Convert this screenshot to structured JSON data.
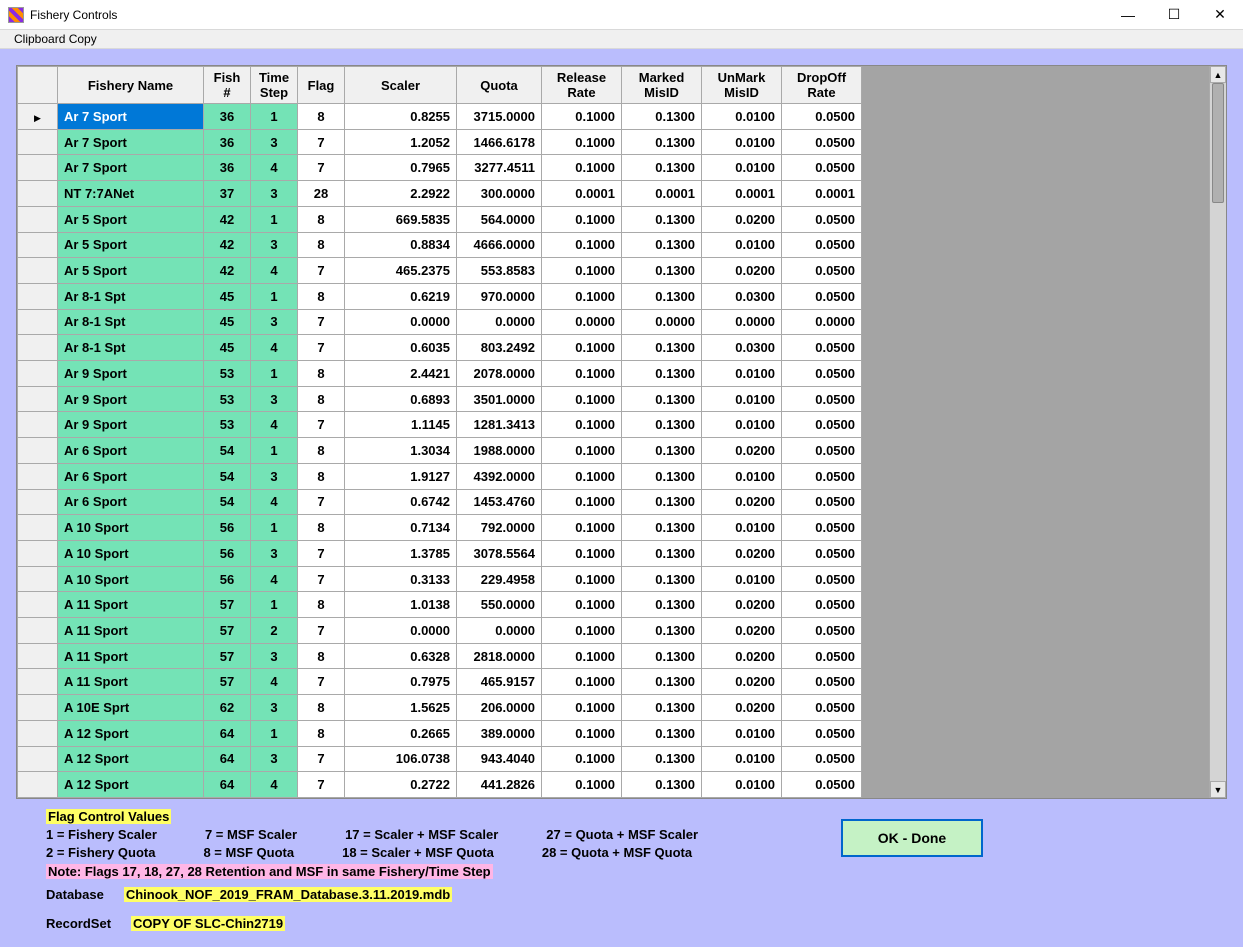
{
  "window": {
    "title": "Fishery Controls"
  },
  "menu": {
    "clipboard": "Clipboard Copy"
  },
  "columns": {
    "name": "Fishery Name",
    "fish": "Fish\n#",
    "time": "Time\nStep",
    "flag": "Flag",
    "scaler": "Scaler",
    "quota": "Quota",
    "rel": "Release\nRate",
    "mmis": "Marked\nMisID",
    "umis": "UnMark\nMisID",
    "drop": "DropOff\nRate"
  },
  "rows": [
    {
      "name": "Ar 7 Sport",
      "fish": 36,
      "time": 1,
      "flag": 8,
      "scaler": "0.8255",
      "quota": "3715.0000",
      "rel": "0.1000",
      "mmis": "0.1300",
      "umis": "0.0100",
      "drop": "0.0500",
      "sel": true
    },
    {
      "name": "Ar 7 Sport",
      "fish": 36,
      "time": 3,
      "flag": 7,
      "scaler": "1.2052",
      "quota": "1466.6178",
      "rel": "0.1000",
      "mmis": "0.1300",
      "umis": "0.0100",
      "drop": "0.0500"
    },
    {
      "name": "Ar 7 Sport",
      "fish": 36,
      "time": 4,
      "flag": 7,
      "scaler": "0.7965",
      "quota": "3277.4511",
      "rel": "0.1000",
      "mmis": "0.1300",
      "umis": "0.0100",
      "drop": "0.0500"
    },
    {
      "name": "NT 7:7ANet",
      "fish": 37,
      "time": 3,
      "flag": 28,
      "scaler": "2.2922",
      "quota": "300.0000",
      "rel": "0.0001",
      "mmis": "0.0001",
      "umis": "0.0001",
      "drop": "0.0001"
    },
    {
      "name": "Ar 5 Sport",
      "fish": 42,
      "time": 1,
      "flag": 8,
      "scaler": "669.5835",
      "quota": "564.0000",
      "rel": "0.1000",
      "mmis": "0.1300",
      "umis": "0.0200",
      "drop": "0.0500"
    },
    {
      "name": "Ar 5 Sport",
      "fish": 42,
      "time": 3,
      "flag": 8,
      "scaler": "0.8834",
      "quota": "4666.0000",
      "rel": "0.1000",
      "mmis": "0.1300",
      "umis": "0.0100",
      "drop": "0.0500"
    },
    {
      "name": "Ar 5 Sport",
      "fish": 42,
      "time": 4,
      "flag": 7,
      "scaler": "465.2375",
      "quota": "553.8583",
      "rel": "0.1000",
      "mmis": "0.1300",
      "umis": "0.0200",
      "drop": "0.0500"
    },
    {
      "name": "Ar 8-1 Spt",
      "fish": 45,
      "time": 1,
      "flag": 8,
      "scaler": "0.6219",
      "quota": "970.0000",
      "rel": "0.1000",
      "mmis": "0.1300",
      "umis": "0.0300",
      "drop": "0.0500"
    },
    {
      "name": "Ar 8-1 Spt",
      "fish": 45,
      "time": 3,
      "flag": 7,
      "scaler": "0.0000",
      "quota": "0.0000",
      "rel": "0.0000",
      "mmis": "0.0000",
      "umis": "0.0000",
      "drop": "0.0000"
    },
    {
      "name": "Ar 8-1 Spt",
      "fish": 45,
      "time": 4,
      "flag": 7,
      "scaler": "0.6035",
      "quota": "803.2492",
      "rel": "0.1000",
      "mmis": "0.1300",
      "umis": "0.0300",
      "drop": "0.0500"
    },
    {
      "name": "Ar 9 Sport",
      "fish": 53,
      "time": 1,
      "flag": 8,
      "scaler": "2.4421",
      "quota": "2078.0000",
      "rel": "0.1000",
      "mmis": "0.1300",
      "umis": "0.0100",
      "drop": "0.0500"
    },
    {
      "name": "Ar 9 Sport",
      "fish": 53,
      "time": 3,
      "flag": 8,
      "scaler": "0.6893",
      "quota": "3501.0000",
      "rel": "0.1000",
      "mmis": "0.1300",
      "umis": "0.0100",
      "drop": "0.0500"
    },
    {
      "name": "Ar 9 Sport",
      "fish": 53,
      "time": 4,
      "flag": 7,
      "scaler": "1.1145",
      "quota": "1281.3413",
      "rel": "0.1000",
      "mmis": "0.1300",
      "umis": "0.0100",
      "drop": "0.0500"
    },
    {
      "name": "Ar 6 Sport",
      "fish": 54,
      "time": 1,
      "flag": 8,
      "scaler": "1.3034",
      "quota": "1988.0000",
      "rel": "0.1000",
      "mmis": "0.1300",
      "umis": "0.0200",
      "drop": "0.0500"
    },
    {
      "name": "Ar 6 Sport",
      "fish": 54,
      "time": 3,
      "flag": 8,
      "scaler": "1.9127",
      "quota": "4392.0000",
      "rel": "0.1000",
      "mmis": "0.1300",
      "umis": "0.0100",
      "drop": "0.0500"
    },
    {
      "name": "Ar 6 Sport",
      "fish": 54,
      "time": 4,
      "flag": 7,
      "scaler": "0.6742",
      "quota": "1453.4760",
      "rel": "0.1000",
      "mmis": "0.1300",
      "umis": "0.0200",
      "drop": "0.0500"
    },
    {
      "name": "A 10 Sport",
      "fish": 56,
      "time": 1,
      "flag": 8,
      "scaler": "0.7134",
      "quota": "792.0000",
      "rel": "0.1000",
      "mmis": "0.1300",
      "umis": "0.0100",
      "drop": "0.0500"
    },
    {
      "name": "A 10 Sport",
      "fish": 56,
      "time": 3,
      "flag": 7,
      "scaler": "1.3785",
      "quota": "3078.5564",
      "rel": "0.1000",
      "mmis": "0.1300",
      "umis": "0.0200",
      "drop": "0.0500"
    },
    {
      "name": "A 10 Sport",
      "fish": 56,
      "time": 4,
      "flag": 7,
      "scaler": "0.3133",
      "quota": "229.4958",
      "rel": "0.1000",
      "mmis": "0.1300",
      "umis": "0.0100",
      "drop": "0.0500"
    },
    {
      "name": "A 11 Sport",
      "fish": 57,
      "time": 1,
      "flag": 8,
      "scaler": "1.0138",
      "quota": "550.0000",
      "rel": "0.1000",
      "mmis": "0.1300",
      "umis": "0.0200",
      "drop": "0.0500"
    },
    {
      "name": "A 11 Sport",
      "fish": 57,
      "time": 2,
      "flag": 7,
      "scaler": "0.0000",
      "quota": "0.0000",
      "rel": "0.1000",
      "mmis": "0.1300",
      "umis": "0.0200",
      "drop": "0.0500"
    },
    {
      "name": "A 11 Sport",
      "fish": 57,
      "time": 3,
      "flag": 8,
      "scaler": "0.6328",
      "quota": "2818.0000",
      "rel": "0.1000",
      "mmis": "0.1300",
      "umis": "0.0200",
      "drop": "0.0500"
    },
    {
      "name": "A 11 Sport",
      "fish": 57,
      "time": 4,
      "flag": 7,
      "scaler": "0.7975",
      "quota": "465.9157",
      "rel": "0.1000",
      "mmis": "0.1300",
      "umis": "0.0200",
      "drop": "0.0500"
    },
    {
      "name": "A 10E Sprt",
      "fish": 62,
      "time": 3,
      "flag": 8,
      "scaler": "1.5625",
      "quota": "206.0000",
      "rel": "0.1000",
      "mmis": "0.1300",
      "umis": "0.0200",
      "drop": "0.0500"
    },
    {
      "name": "A 12 Sport",
      "fish": 64,
      "time": 1,
      "flag": 8,
      "scaler": "0.2665",
      "quota": "389.0000",
      "rel": "0.1000",
      "mmis": "0.1300",
      "umis": "0.0100",
      "drop": "0.0500"
    },
    {
      "name": "A 12 Sport",
      "fish": 64,
      "time": 3,
      "flag": 7,
      "scaler": "106.0738",
      "quota": "943.4040",
      "rel": "0.1000",
      "mmis": "0.1300",
      "umis": "0.0100",
      "drop": "0.0500"
    },
    {
      "name": "A 12 Sport",
      "fish": 64,
      "time": 4,
      "flag": 7,
      "scaler": "0.2722",
      "quota": "441.2826",
      "rel": "0.1000",
      "mmis": "0.1300",
      "umis": "0.0100",
      "drop": "0.0500"
    }
  ],
  "footer": {
    "flagheader": "Flag Control Values",
    "flags": [
      [
        "1 = Fishery Scaler",
        "7 = MSF Scaler",
        "17 = Scaler + MSF Scaler",
        "27 = Quota + MSF Scaler"
      ],
      [
        "2 = Fishery Quota",
        "8 = MSF Quota",
        "18 = Scaler + MSF Quota",
        "28 = Quota + MSF Quota"
      ]
    ],
    "note": "Note: Flags 17, 18, 27, 28 Retention and MSF in same Fishery/Time Step",
    "db_label": "Database",
    "db_value": "Chinook_NOF_2019_FRAM_Database.3.11.2019.mdb",
    "rs_label": "RecordSet",
    "rs_value": "COPY OF SLC-Chin2719",
    "ok": "OK - Done"
  }
}
